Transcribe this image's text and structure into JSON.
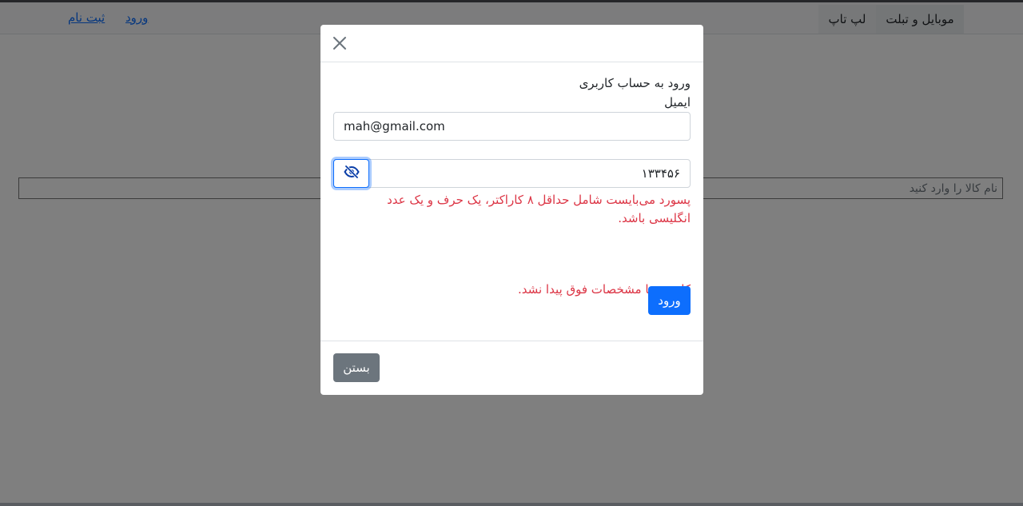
{
  "navbar": {
    "categories": [
      "موبایل و تبلت",
      "لپ تاپ"
    ],
    "login_link": "ورود",
    "register_link": "ثبت نام"
  },
  "search": {
    "placeholder": "نام کالا را وارد کنید"
  },
  "modal": {
    "heading": "ورود به حساب کاربری",
    "email_label": "ایمیل",
    "email_value": "mah@gmail.com",
    "password_value": "۱۳۳۴۵۶",
    "password_error": "پسورد می‌بایست شامل حداقل ۸ کاراکتر، یک حرف و یک عدد انگلیسی باشد.",
    "user_error": "کاربری با مشخصات فوق پیدا نشد.",
    "login_button": "ورود",
    "close_button": "بستن"
  },
  "colors": {
    "primary": "#0d6efd",
    "danger": "#dc3545",
    "secondary": "#6c757d"
  },
  "icons": {
    "close": "close-icon",
    "toggle_password": "eye-slash-icon"
  }
}
